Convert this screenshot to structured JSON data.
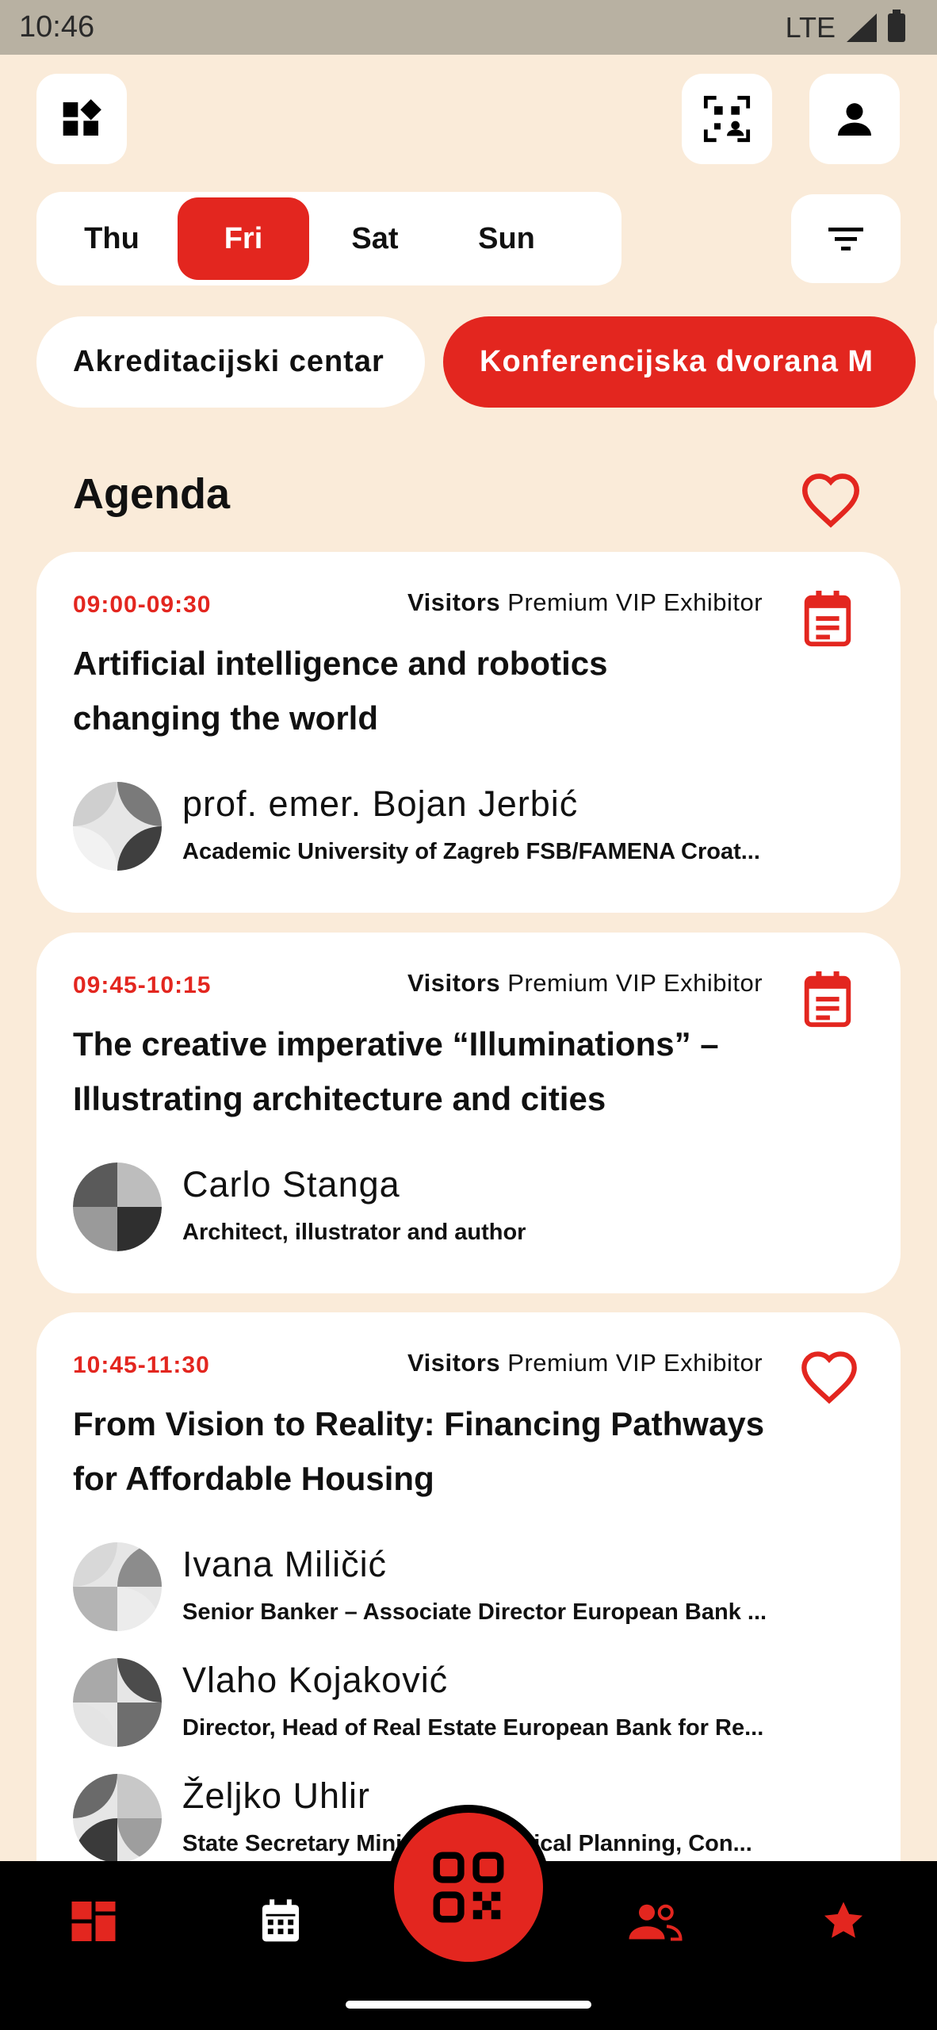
{
  "status": {
    "time": "10:46",
    "network": "LTE"
  },
  "days": [
    "Thu",
    "Fri",
    "Sat",
    "Sun"
  ],
  "active_day": "Fri",
  "locations": [
    "Akreditacijski centar",
    "Konferencijska dvorana M"
  ],
  "active_location": "Konferencijska dvorana M",
  "agenda": {
    "title": "Agenda"
  },
  "sessions": [
    {
      "time": "09:00-09:30",
      "tags": [
        "Visitors",
        "Premium",
        "VIP",
        "Exhibitor"
      ],
      "action_icon": "calendar-icon",
      "title_lines": [
        "Artificial intelligence and robotics",
        "changing the world"
      ],
      "speakers": [
        {
          "name": "prof. emer. Bojan Jerbić",
          "role": "Academic University of Zagreb FSB/FAMENA Croat..."
        }
      ]
    },
    {
      "time": "09:45-10:15",
      "tags": [
        "Visitors",
        "Premium",
        "VIP",
        "Exhibitor"
      ],
      "action_icon": "calendar-icon",
      "title_lines": [
        "The creative imperative “Illuminations” –",
        "Illustrating architecture and cities"
      ],
      "speakers": [
        {
          "name": "Carlo Stanga",
          "role": "Architect, illustrator and author"
        }
      ]
    },
    {
      "time": "10:45-11:30",
      "tags": [
        "Visitors",
        "Premium",
        "VIP",
        "Exhibitor"
      ],
      "action_icon": "heart-icon",
      "title_lines": [
        "From Vision to Reality: Financing Pathways",
        "for Affordable Housing"
      ],
      "speakers": [
        {
          "name": "Ivana Miličić",
          "role": "Senior Banker – Associate Director European Bank ..."
        },
        {
          "name": "Vlaho Kojaković",
          "role": "Director, Head of Real Estate European Bank for Re..."
        },
        {
          "name": "Željko Uhlir",
          "role": "State Secretary Ministry of Physical Planning, Con..."
        }
      ]
    }
  ],
  "colors": {
    "accent": "#e3261f",
    "background": "#faebd9"
  },
  "nav": [
    "dashboard-icon",
    "calendar-icon",
    "qr-code-icon",
    "people-icon",
    "star-icon"
  ]
}
